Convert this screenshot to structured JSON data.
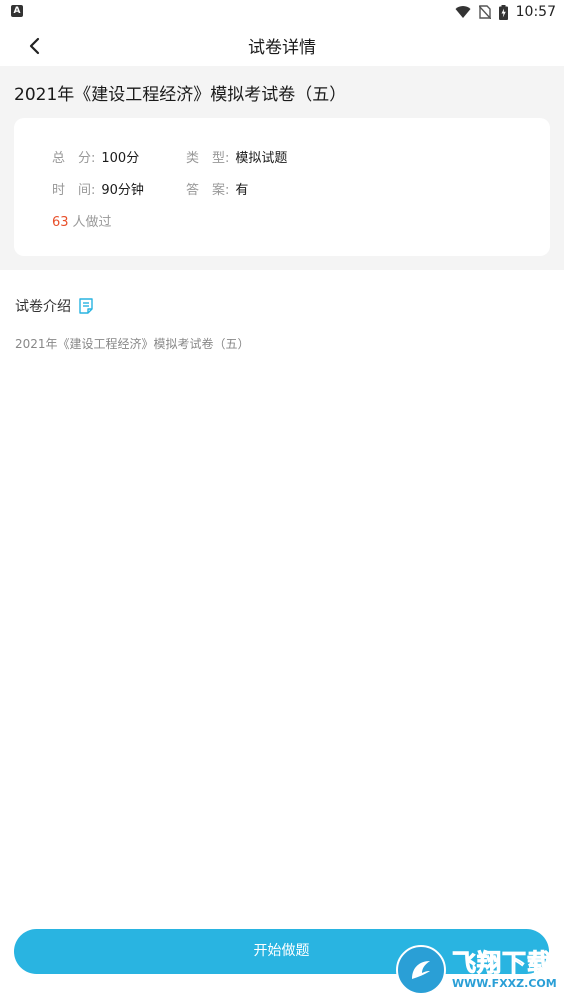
{
  "status_bar": {
    "time": "10:57",
    "app_badge": "A"
  },
  "nav": {
    "title": "试卷详情"
  },
  "exam": {
    "title": "2021年《建设工程经济》模拟考试卷（五）",
    "info": {
      "score_label": "总　分:",
      "score_value": "100分",
      "type_label": "类　型:",
      "type_value": "模拟试题",
      "time_label": "时　间:",
      "time_value": "90分钟",
      "answer_label": "答　案:",
      "answer_value": "有",
      "done_count": "63",
      "done_suffix": "人做过"
    }
  },
  "intro": {
    "title": "试卷介绍",
    "description": "2021年《建设工程经济》模拟考试卷（五）"
  },
  "actions": {
    "start_label": "开始做题"
  },
  "watermark": {
    "cn": "飞翔下载",
    "en": "WWW.FXXZ.COM"
  },
  "colors": {
    "accent": "#29b4e1",
    "count": "#e8502b"
  }
}
